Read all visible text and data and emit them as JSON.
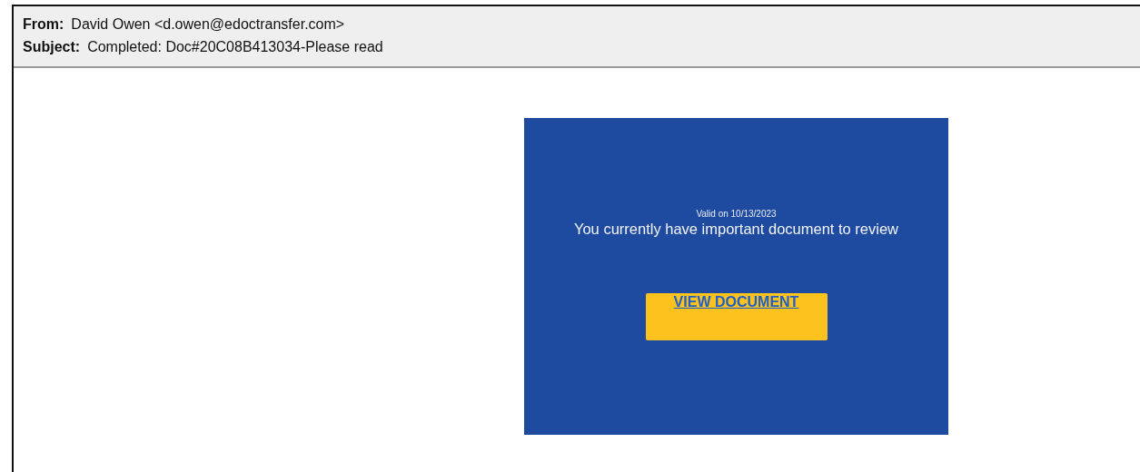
{
  "header": {
    "from_label": "From:",
    "from_value": "David Owen <d.owen@edoctransfer.com>",
    "subject_label": "Subject:",
    "subject_value": "Completed: Doc#20C08B413034-Please read"
  },
  "card": {
    "valid_note": "Valid on 10/13/2023",
    "headline": "You currently have important document to review",
    "button": "VIEW DOCUMENT"
  }
}
